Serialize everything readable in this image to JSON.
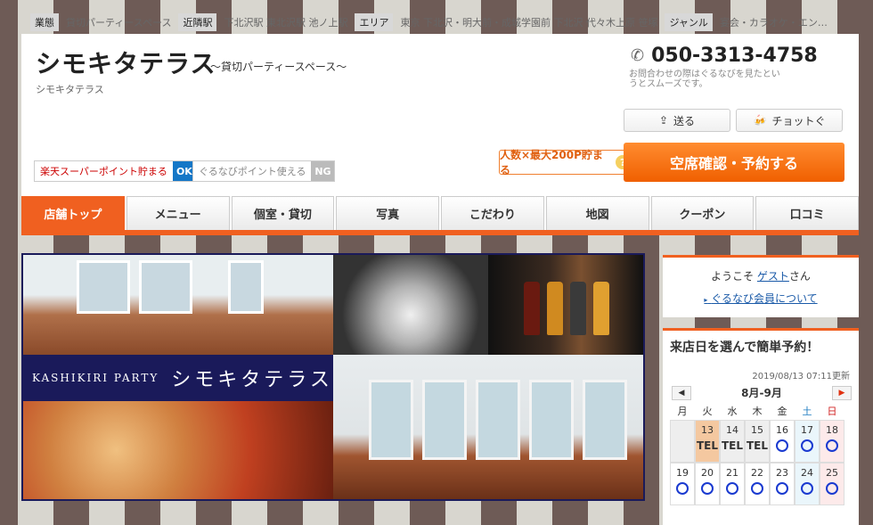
{
  "topbar": {
    "items": [
      {
        "label": "業態",
        "value": "貸切パーティースペース"
      },
      {
        "label": "近隣駅",
        "value": "下北沢駅 東北沢駅 池ノ上駅"
      },
      {
        "label": "エリア",
        "value": "東京 下北沢・明大前・成城学園前 下北沢 代々木上原 笹塚"
      },
      {
        "label": "ジャンル",
        "value": "宴会・カラオケ・エン…"
      }
    ]
  },
  "header": {
    "title": "シモキタテラス",
    "subtitle": "～貸切パーティースペース～",
    "small": "シモキタテラス",
    "phone": "050-3313-4758",
    "phone_note": "お問合わせの際はぐるなびを見たというとスムーズです。",
    "send_label": "送る",
    "chotto_label": "チョットぐ",
    "rakuten_label": "楽天スーパーポイント貯まる",
    "rakuten_status": "OK",
    "gnavi_label": "ぐるなびポイント使える",
    "gnavi_status": "NG",
    "promo_label": "人数×最大200P貯まる",
    "promo_q": "?",
    "reserve_label": "空席確認・予約する"
  },
  "nav": {
    "items": [
      "店舗トップ",
      "メニュー",
      "個室・貸切",
      "写真",
      "こだわり",
      "地図",
      "クーポン",
      "口コミ"
    ]
  },
  "hero": {
    "en": "KASHIKIRI PARTY",
    "jp": "シモキタテラス"
  },
  "sidebar": {
    "welcome_prefix": "ようこそ",
    "guest": "ゲスト",
    "welcome_suffix": "さん",
    "member_link": "ぐるなび会員について"
  },
  "calendar": {
    "title": "来店日を選んで簡単予約！",
    "updated": "2019/08/13 07:11更新",
    "month": "8月-9月",
    "dow": [
      "月",
      "火",
      "水",
      "木",
      "金",
      "土",
      "日"
    ],
    "week1": [
      {
        "d": "",
        "m": ""
      },
      {
        "d": "13",
        "m": "TEL"
      },
      {
        "d": "14",
        "m": "TEL"
      },
      {
        "d": "15",
        "m": "TEL"
      },
      {
        "d": "16",
        "m": "○"
      },
      {
        "d": "17",
        "m": "○"
      },
      {
        "d": "18",
        "m": "○"
      }
    ],
    "week2": [
      {
        "d": "19",
        "m": "○"
      },
      {
        "d": "20",
        "m": "○"
      },
      {
        "d": "21",
        "m": "○"
      },
      {
        "d": "22",
        "m": "○"
      },
      {
        "d": "23",
        "m": "○"
      },
      {
        "d": "24",
        "m": "○"
      },
      {
        "d": "25",
        "m": "○"
      }
    ]
  },
  "colors": {
    "accent": "#f06020",
    "link": "#1a5aa8",
    "navy": "#1a1a5a"
  }
}
